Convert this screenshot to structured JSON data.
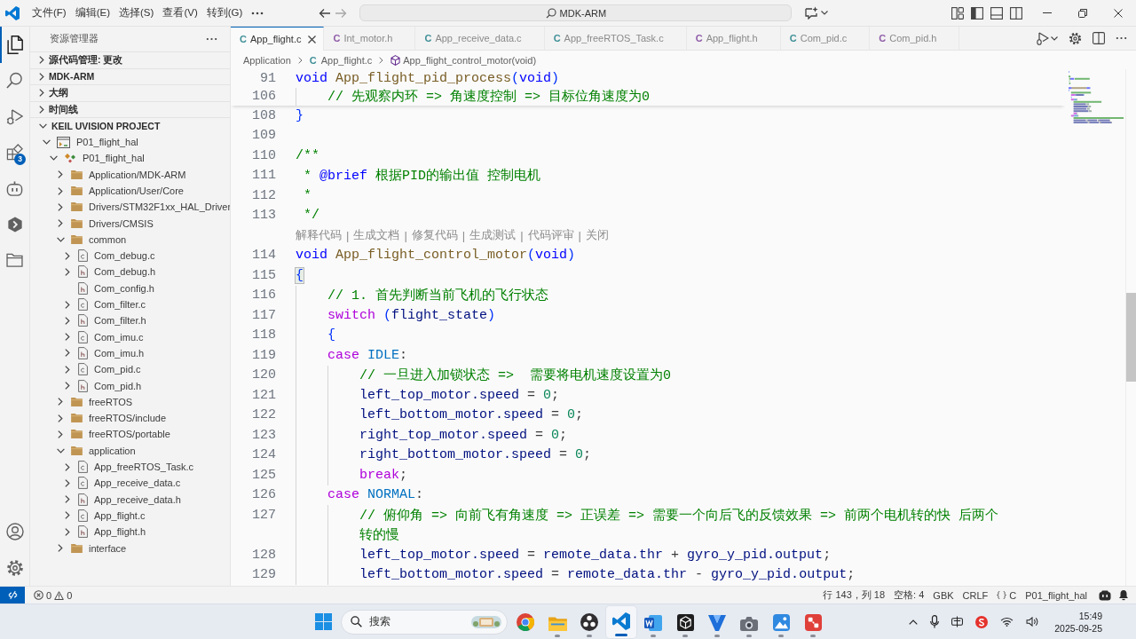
{
  "title_bar": {
    "menus": [
      "文件(F)",
      "编辑(E)",
      "选择(S)",
      "查看(V)",
      "转到(G)"
    ],
    "command_center": "MDK-ARM"
  },
  "activity_bar": {
    "top": [
      {
        "kind": "explorer",
        "selected": true
      },
      {
        "kind": "search",
        "selected": false
      },
      {
        "kind": "run_debug",
        "selected": false
      },
      {
        "kind": "extensions",
        "selected": false,
        "badge": "3"
      },
      {
        "kind": "assistant",
        "selected": false
      },
      {
        "kind": "hexagon",
        "selected": false
      },
      {
        "kind": "folders",
        "selected": false
      }
    ],
    "bottom": [
      {
        "kind": "account"
      },
      {
        "kind": "settings"
      }
    ]
  },
  "sidebar": {
    "title": "资源管理器",
    "sections": [
      {
        "label": "源代码管理: 更改",
        "expanded": false
      },
      {
        "label": "MDK-ARM",
        "expanded": false
      },
      {
        "label": "大纲",
        "expanded": false
      },
      {
        "label": "时间线",
        "expanded": false
      },
      {
        "label": "KEIL UVISION PROJECT",
        "expanded": true,
        "tree": [
          {
            "label": "P01_flight_hal",
            "kind": "project",
            "expanded": true,
            "children": [
              {
                "label": "P01_flight_hal",
                "kind": "target",
                "expanded": true,
                "children": [
                  {
                    "label": "Application/MDK-ARM",
                    "kind": "folder",
                    "expanded": false
                  },
                  {
                    "label": "Application/User/Core",
                    "kind": "folder",
                    "expanded": false
                  },
                  {
                    "label": "Drivers/STM32F1xx_HAL_Driver",
                    "kind": "folder",
                    "expanded": false
                  },
                  {
                    "label": "Drivers/CMSIS",
                    "kind": "folder",
                    "expanded": false
                  },
                  {
                    "label": "common",
                    "kind": "folder",
                    "expanded": true,
                    "children": [
                      {
                        "label": "Com_debug.c",
                        "kind": "source",
                        "expandable": true
                      },
                      {
                        "label": "Com_debug.h",
                        "kind": "header",
                        "expandable": true
                      },
                      {
                        "label": "Com_config.h",
                        "kind": "header",
                        "expandable": false
                      },
                      {
                        "label": "Com_filter.c",
                        "kind": "source",
                        "expandable": true
                      },
                      {
                        "label": "Com_filter.h",
                        "kind": "header",
                        "expandable": true
                      },
                      {
                        "label": "Com_imu.c",
                        "kind": "source",
                        "expandable": true
                      },
                      {
                        "label": "Com_imu.h",
                        "kind": "header",
                        "expandable": true
                      },
                      {
                        "label": "Com_pid.c",
                        "kind": "source",
                        "expandable": true
                      },
                      {
                        "label": "Com_pid.h",
                        "kind": "header",
                        "expandable": true
                      }
                    ]
                  },
                  {
                    "label": "freeRTOS",
                    "kind": "folder",
                    "expanded": false
                  },
                  {
                    "label": "freeRTOS/include",
                    "kind": "folder",
                    "expanded": false
                  },
                  {
                    "label": "freeRTOS/portable",
                    "kind": "folder",
                    "expanded": false
                  },
                  {
                    "label": "application",
                    "kind": "folder",
                    "expanded": true,
                    "children": [
                      {
                        "label": "App_freeRTOS_Task.c",
                        "kind": "source",
                        "expandable": true
                      },
                      {
                        "label": "App_receive_data.c",
                        "kind": "source",
                        "expandable": true
                      },
                      {
                        "label": "App_receive_data.h",
                        "kind": "header",
                        "expandable": true
                      },
                      {
                        "label": "App_flight.c",
                        "kind": "source",
                        "expandable": true
                      },
                      {
                        "label": "App_flight.h",
                        "kind": "header",
                        "expandable": true
                      }
                    ]
                  },
                  {
                    "label": "interface",
                    "kind": "folder",
                    "expanded": false
                  }
                ]
              }
            ]
          }
        ]
      }
    ]
  },
  "tabs": [
    {
      "glyph": "C",
      "label": "App_flight.c",
      "kind": "source",
      "selected": true
    },
    {
      "glyph": "C",
      "label": "Int_motor.h",
      "kind": "header",
      "selected": false
    },
    {
      "glyph": "C",
      "label": "App_receive_data.c",
      "kind": "source",
      "selected": false
    },
    {
      "glyph": "C",
      "label": "App_freeRTOS_Task.c",
      "kind": "source",
      "selected": false
    },
    {
      "glyph": "C",
      "label": "App_flight.h",
      "kind": "header",
      "selected": false
    },
    {
      "glyph": "C",
      "label": "Com_pid.c",
      "kind": "source",
      "selected": false
    },
    {
      "glyph": "C",
      "label": "Com_pid.h",
      "kind": "header",
      "selected": false
    }
  ],
  "breadcrumb": [
    {
      "kind": "folder",
      "label": "Application"
    },
    {
      "kind": "file",
      "glyph": "C",
      "label": "App_flight.c"
    },
    {
      "kind": "symbol",
      "label": "App_flight_control_motor(void)"
    }
  ],
  "editor": {
    "sticky_lines": [
      {
        "number": "91",
        "tokens": [
          {
            "text": "void ",
            "kind": "keyword"
          },
          {
            "text": "App_flight_pid_process",
            "kind": "function"
          },
          {
            "text": "(",
            "kind": "bracket"
          },
          {
            "text": "void",
            "kind": "keyword"
          },
          {
            "text": ")",
            "kind": "bracket"
          }
        ]
      },
      {
        "number": "106",
        "tokens": [
          {
            "text": "    // 先观察内环 => 角速度控制 => 目标位角速度为0",
            "kind": "comment"
          }
        ]
      }
    ],
    "lines": [
      {
        "kind": "code",
        "number": "108",
        "tokens": [
          {
            "text": "}",
            "kind": "bracket",
            "highlighted": false
          }
        ]
      },
      {
        "kind": "code",
        "number": "109"
      },
      {
        "kind": "code",
        "number": "110",
        "tokens": [
          {
            "text": "/**",
            "kind": "comment"
          }
        ]
      },
      {
        "kind": "code",
        "number": "111",
        "tokens": [
          {
            "text": " * ",
            "kind": "comment"
          },
          {
            "text": "@brief",
            "kind": "doctag"
          },
          {
            "text": " 根据PID的输出值 控制电机",
            "kind": "comment"
          }
        ]
      },
      {
        "kind": "code",
        "number": "112",
        "tokens": [
          {
            "text": " *",
            "kind": "comment"
          }
        ]
      },
      {
        "kind": "code",
        "number": "113",
        "tokens": [
          {
            "text": " */",
            "kind": "comment"
          }
        ]
      },
      {
        "kind": "codelens",
        "actions": [
          "解释代码",
          "生成文档",
          "修复代码",
          "生成测试",
          "代码评审",
          "关闭"
        ],
        "separator": "|"
      },
      {
        "kind": "code",
        "number": "114",
        "tokens": [
          {
            "text": "void ",
            "kind": "keyword"
          },
          {
            "text": "App_flight_control_motor",
            "kind": "function"
          },
          {
            "text": "(",
            "kind": "bracket"
          },
          {
            "text": "void",
            "kind": "keyword"
          },
          {
            "text": ")",
            "kind": "bracket"
          }
        ]
      },
      {
        "kind": "code",
        "number": "115",
        "tokens": [
          {
            "text": "{",
            "kind": "bracket",
            "highlighted": true
          }
        ]
      },
      {
        "kind": "code",
        "number": "116",
        "tokens": [
          {
            "text": "    // 1. 首先判断当前飞机的飞行状态",
            "kind": "comment"
          }
        ]
      },
      {
        "kind": "code",
        "number": "117",
        "tokens": [
          {
            "text": "    switch ",
            "kind": "control"
          },
          {
            "text": "(",
            "kind": "bracket"
          },
          {
            "text": "flight_state",
            "kind": "variable"
          },
          {
            "text": ")",
            "kind": "bracket"
          }
        ]
      },
      {
        "kind": "code",
        "number": "118",
        "tokens": [
          {
            "text": "    {",
            "kind": "bracket",
            "highlighted": false
          }
        ]
      },
      {
        "kind": "code",
        "number": "119",
        "tokens": [
          {
            "text": "    case ",
            "kind": "control"
          },
          {
            "text": "IDLE",
            "kind": "constant"
          },
          {
            "text": ":",
            "kind": "plain"
          }
        ]
      },
      {
        "kind": "code",
        "number": "120",
        "tokens": [
          {
            "text": "        // 一旦进入加锁状态 =>  需要将电机速度设置为0",
            "kind": "comment"
          }
        ]
      },
      {
        "kind": "code",
        "number": "121",
        "tokens": [
          {
            "text": "        left_top_motor.speed",
            "kind": "variable"
          },
          {
            "text": " = ",
            "kind": "plain"
          },
          {
            "text": "0",
            "kind": "number"
          },
          {
            "text": ";",
            "kind": "plain"
          }
        ]
      },
      {
        "kind": "code",
        "number": "122",
        "tokens": [
          {
            "text": "        left_bottom_motor.speed",
            "kind": "variable"
          },
          {
            "text": " = ",
            "kind": "plain"
          },
          {
            "text": "0",
            "kind": "number"
          },
          {
            "text": ";",
            "kind": "plain"
          }
        ]
      },
      {
        "kind": "code",
        "number": "123",
        "tokens": [
          {
            "text": "        right_top_motor.speed",
            "kind": "variable"
          },
          {
            "text": " = ",
            "kind": "plain"
          },
          {
            "text": "0",
            "kind": "number"
          },
          {
            "text": ";",
            "kind": "plain"
          }
        ]
      },
      {
        "kind": "code",
        "number": "124",
        "tokens": [
          {
            "text": "        right_bottom_motor.speed",
            "kind": "variable"
          },
          {
            "text": " = ",
            "kind": "plain"
          },
          {
            "text": "0",
            "kind": "number"
          },
          {
            "text": ";",
            "kind": "plain"
          }
        ]
      },
      {
        "kind": "code",
        "number": "125",
        "tokens": [
          {
            "text": "        break",
            "kind": "control"
          },
          {
            "text": ";",
            "kind": "plain"
          }
        ]
      },
      {
        "kind": "code",
        "number": "126",
        "tokens": [
          {
            "text": "    case ",
            "kind": "control"
          },
          {
            "text": "NORMAL",
            "kind": "constant"
          },
          {
            "text": ":",
            "kind": "plain"
          }
        ]
      },
      {
        "kind": "code",
        "number": "127",
        "tokens": [
          {
            "text": "        // 俯仰角 => 向前飞有角速度 => 正误差 => 需要一个向后飞的反馈效果 => 前两个电机转的快 后两个",
            "kind": "comment"
          }
        ],
        "continuation": [
          {
            "text": "转的慢",
            "kind": "comment"
          }
        ]
      },
      {
        "kind": "code",
        "number": "128",
        "tokens": [
          {
            "text": "        left_top_motor.speed",
            "kind": "variable"
          },
          {
            "text": " = ",
            "kind": "plain"
          },
          {
            "text": "remote_data.thr",
            "kind": "variable"
          },
          {
            "text": " + ",
            "kind": "plain"
          },
          {
            "text": "gyro_y_pid.output",
            "kind": "variable"
          },
          {
            "text": ";",
            "kind": "plain"
          }
        ]
      },
      {
        "kind": "code",
        "number": "129",
        "tokens": [
          {
            "text": "        left_bottom_motor.speed",
            "kind": "variable"
          },
          {
            "text": " = ",
            "kind": "plain"
          },
          {
            "text": "remote_data.thr",
            "kind": "variable"
          },
          {
            "text": " - ",
            "kind": "plain"
          },
          {
            "text": "gyro_y_pid.output",
            "kind": "variable"
          },
          {
            "text": ";",
            "kind": "plain"
          }
        ]
      }
    ]
  },
  "status_bar": {
    "problems": {
      "errors": "0",
      "warnings": "0"
    },
    "items": [
      {
        "kind": "text",
        "label": "行 143，列 18"
      },
      {
        "kind": "text",
        "label": "空格: 4"
      },
      {
        "kind": "text",
        "label": "GBK"
      },
      {
        "kind": "text",
        "label": "CRLF"
      },
      {
        "kind": "language",
        "label": "C"
      },
      {
        "kind": "text",
        "label": "P01_flight_hal"
      }
    ]
  },
  "taskbar": {
    "search_placeholder": "搜索",
    "apps": [
      {
        "kind": "browser",
        "running": false,
        "active": false
      },
      {
        "kind": "files",
        "running": true,
        "active": false
      },
      {
        "kind": "recorder",
        "running": true,
        "active": false
      },
      {
        "kind": "code_editor",
        "running": true,
        "active": true
      },
      {
        "kind": "word",
        "running": true,
        "active": false
      },
      {
        "kind": "cube",
        "running": true,
        "active": false
      },
      {
        "kind": "v_app",
        "running": true,
        "active": false
      },
      {
        "kind": "camera",
        "running": true,
        "active": false
      },
      {
        "kind": "photos",
        "running": true,
        "active": false
      },
      {
        "kind": "red_app",
        "running": true,
        "active": false
      }
    ],
    "clock": {
      "time": "15:49",
      "date": "2025-09-25"
    }
  }
}
